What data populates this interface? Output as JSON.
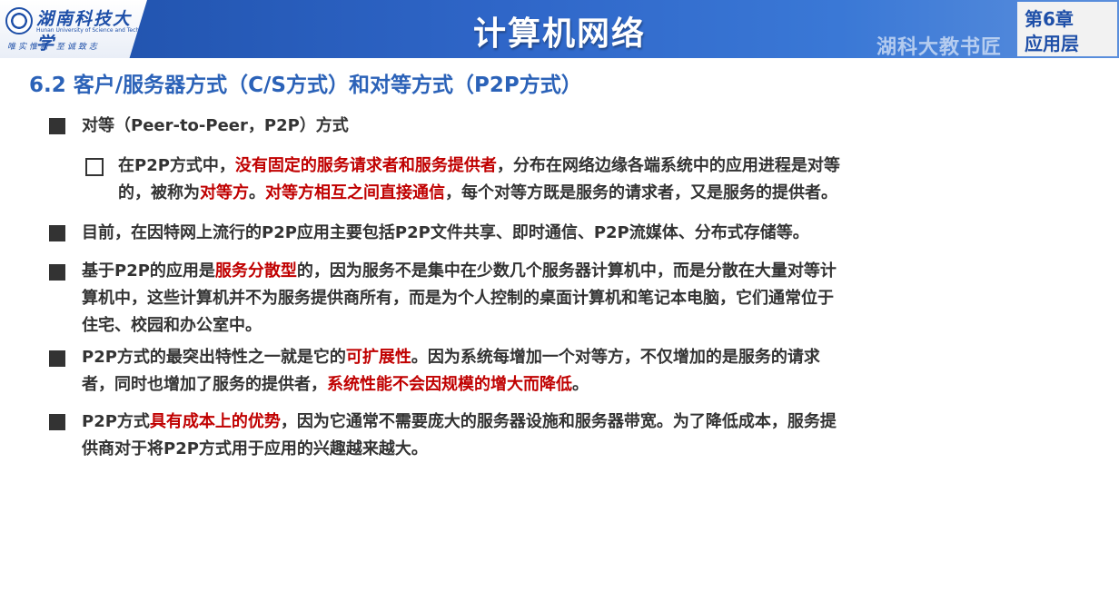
{
  "header": {
    "title": "计算机网络",
    "logo": {
      "name": "湖南科技大学",
      "english": "Hunan University of Science and Technology",
      "motto": "唯实惟新 至诚致志"
    },
    "chapter": {
      "number": "第6章",
      "name": "应用层"
    },
    "watermark": "湖科大教书匠"
  },
  "section_title": "6.2 客户/服务器方式（C/S方式）和对等方式（P2P方式）",
  "bullets": {
    "b1": {
      "text": "对等（Peer-to-Peer，P2P）方式"
    },
    "sub1": {
      "l1_a": "在P2P方式中，",
      "l1_b": "没有固定的服务请求者和服务提供者",
      "l1_c": "，分布在网络边缘各端系统中的应用进程是对等",
      "l2_a": "的，被称为",
      "l2_b": "对等方",
      "l2_c": "。",
      "l2_d": "对等方相互之间直接通信",
      "l2_e": "，每个对等方既是服务的请求者，又是服务的提供者。"
    },
    "b2": {
      "text": "目前，在因特网上流行的P2P应用主要包括P2P文件共享、即时通信、P2P流媒体、分布式存储等。"
    },
    "b3": {
      "l1_a": "基于P2P的应用是",
      "l1_b": "服务分散型",
      "l1_c": "的，因为服务不是集中在少数几个服务器计算机中，而是分散在大量对等计",
      "l2": "算机中，这些计算机并不为服务提供商所有，而是为个人控制的桌面计算机和笔记本电脑，它们通常位于",
      "l3": "住宅、校园和办公室中。"
    },
    "b4": {
      "l1_a": "P2P方式的最突出特性之一就是它的",
      "l1_b": "可扩展性",
      "l1_c": "。因为系统每增加一个对等方，不仅增加的是服务的请求",
      "l2_a": "者，同时也增加了服务的提供者，",
      "l2_b": "系统性能不会因规模的增大而降低",
      "l2_c": "。"
    },
    "b5": {
      "l1_a": "P2P方式",
      "l1_b": "具有成本上的优势",
      "l1_c": "，因为它通常不需要庞大的服务器设施和服务器带宽。为了降低成本，服务提",
      "l2": "供商对于将P2P方式用于应用的兴趣越来越大。"
    }
  },
  "colors": {
    "header_blue": "#1e4fa8",
    "title_blue": "#2b62b8",
    "highlight_red": "#c00000",
    "body_text": "#333333"
  }
}
